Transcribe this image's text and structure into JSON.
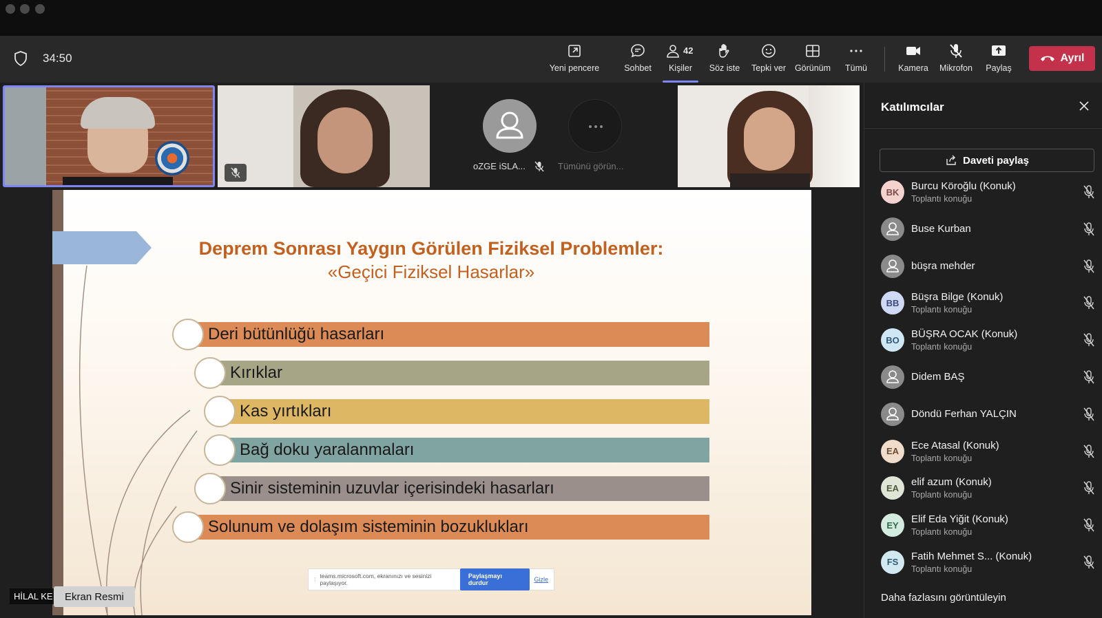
{
  "meeting": {
    "timer": "34:50"
  },
  "toolbar": {
    "new_window": "Yeni pencere",
    "chat": "Sohbet",
    "people": "Kişiler",
    "people_count": "42",
    "raise_hand": "Söz iste",
    "react": "Tepki ver",
    "view": "Görünüm",
    "more": "Tümü",
    "camera": "Kamera",
    "mic": "Mikrofon",
    "share": "Paylaş",
    "leave": "Ayrıl"
  },
  "video_strip": {
    "avatar_name": "oZGE iSLA...",
    "see_all": "Tümünü görün..."
  },
  "slide": {
    "title": "Deprem Sonrası Yaygın Görülen Fiziksel Problemler:",
    "subtitle": "«Geçici Fiziksel Hasarlar»",
    "items": [
      {
        "label": "Deri bütünlüğü hasarları",
        "color": "#dc8a56"
      },
      {
        "label": "Kırıklar",
        "color": "#a6a585"
      },
      {
        "label": "Kas yırtıkları",
        "color": "#ddb763"
      },
      {
        "label": "Bağ doku yaralanmaları",
        "color": "#7fa4a1"
      },
      {
        "label": "Sinir sisteminin uzuvlar içerisindeki hasarları",
        "color": "#9b8f8c"
      },
      {
        "label": "Solunum ve dolaşım sisteminin bozuklukları",
        "color": "#dc8a56"
      }
    ],
    "share_notice": "teams.microsoft.com, ekranınızı ve sesinizi paylaşıyor.",
    "stop_sharing": "Paylaşmayı durdur",
    "hide": "Gizle"
  },
  "overlay": {
    "name_tag": "HİLAL KE",
    "tooltip": "Ekran Resmi"
  },
  "panel": {
    "title": "Katılımcılar",
    "invite": "Daveti paylaş",
    "more": "Daha fazlasını görüntüleyin",
    "participants": [
      {
        "initials": "BK",
        "name": "Burcu Köroğlu (Konuk)",
        "role": "Toplantı konuğu",
        "bg": "#f4d3cf",
        "fg": "#7a4a45"
      },
      {
        "initials": "",
        "name": "Buse Kurban",
        "role": "",
        "bg": "#8a8a8a",
        "fg": "#ffffff"
      },
      {
        "initials": "",
        "name": "büşra mehder",
        "role": "",
        "bg": "#8a8a8a",
        "fg": "#ffffff"
      },
      {
        "initials": "BB",
        "name": "Büşra Bilge (Konuk)",
        "role": "Toplantı konuğu",
        "bg": "#cfd9f4",
        "fg": "#3a4a7a"
      },
      {
        "initials": "BO",
        "name": "BÜŞRA OCAK (Konuk)",
        "role": "Toplantı konuğu",
        "bg": "#cfe6f4",
        "fg": "#2f5a7a"
      },
      {
        "initials": "",
        "name": "Didem BAŞ",
        "role": "",
        "bg": "#8a8a8a",
        "fg": "#ffffff"
      },
      {
        "initials": "",
        "name": "Döndü Ferhan YALÇIN",
        "role": "",
        "bg": "#8a8a8a",
        "fg": "#ffffff"
      },
      {
        "initials": "EA",
        "name": "Ece Atasal (Konuk)",
        "role": "Toplantı konuğu",
        "bg": "#f1dccb",
        "fg": "#6b4a32"
      },
      {
        "initials": "EA",
        "name": "elif azum (Konuk)",
        "role": "Toplantı konuğu",
        "bg": "#dfe6d5",
        "fg": "#4a5a3a"
      },
      {
        "initials": "EY",
        "name": "Elif Eda Yiğit (Konuk)",
        "role": "Toplantı konuğu",
        "bg": "#d4ecdf",
        "fg": "#2f6a4a"
      },
      {
        "initials": "FS",
        "name": "Fatih Mehmet S...  (Konuk)",
        "role": "Toplantı konuğu",
        "bg": "#d3e9f2",
        "fg": "#2f5a72"
      }
    ]
  },
  "colors": {
    "accent": "#7f85f5",
    "leave": "#c4314b",
    "slide_title": "#c2611f"
  }
}
